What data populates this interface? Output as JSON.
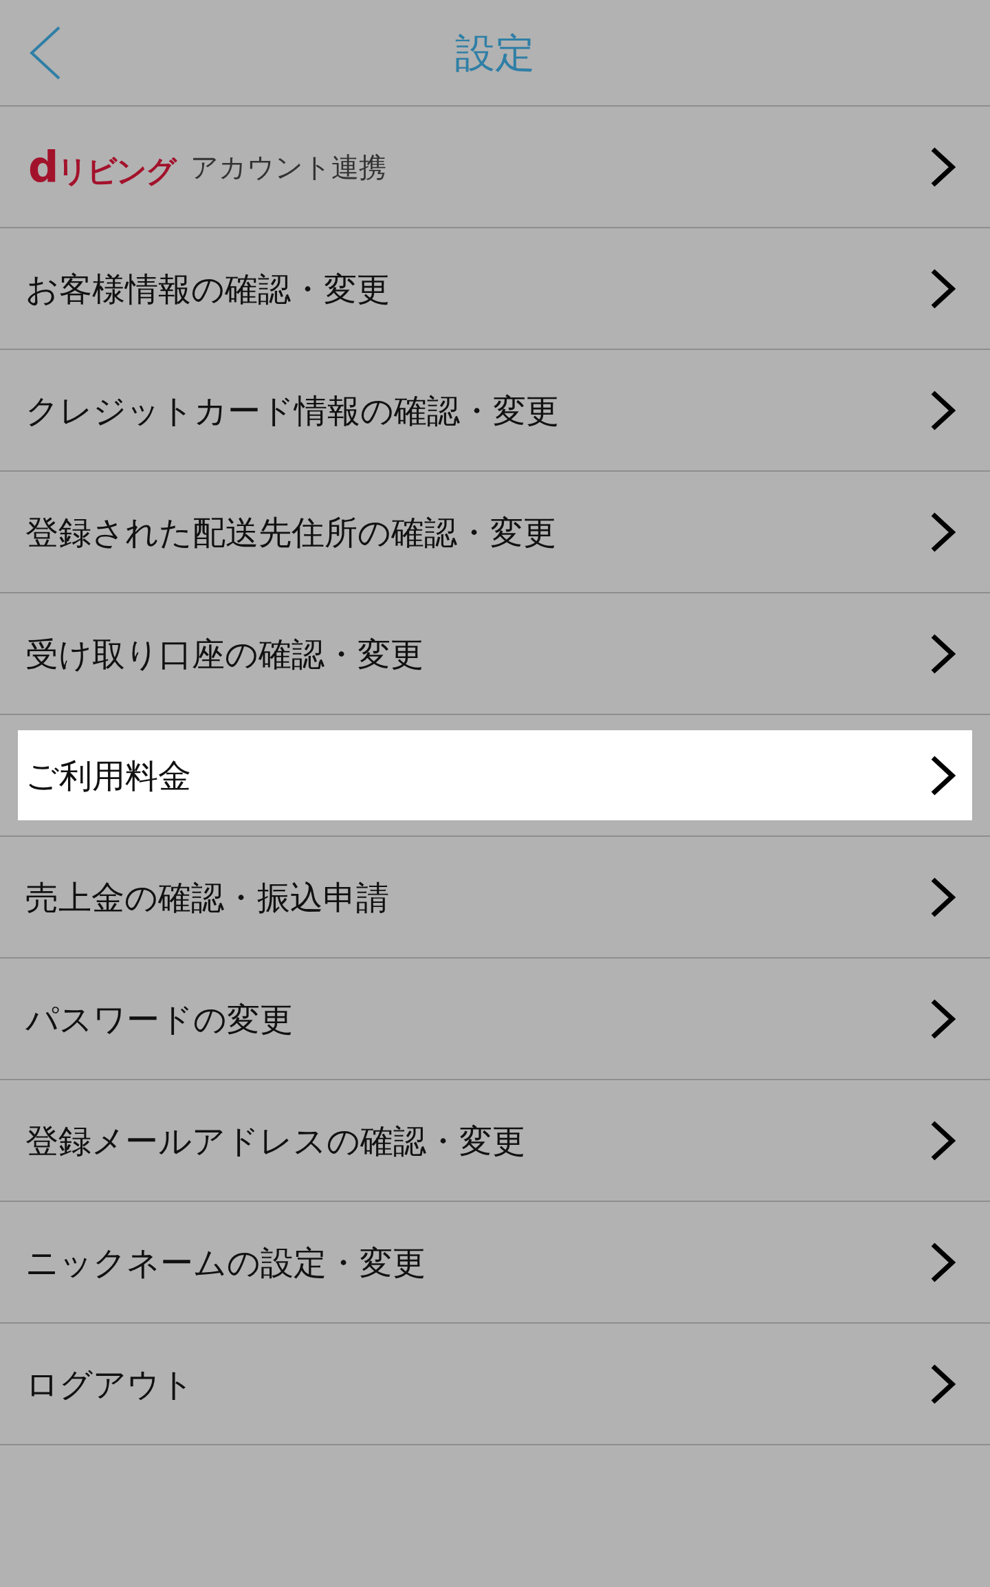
{
  "header": {
    "title": "設定"
  },
  "menu": {
    "items": [
      {
        "kind": "linked_account",
        "logo": "dリビング",
        "label": "アカウント連携",
        "selected": false
      },
      {
        "kind": "link",
        "label": "お客様情報の確認・変更",
        "selected": false
      },
      {
        "kind": "link",
        "label": "クレジットカード情報の確認・変更",
        "selected": false
      },
      {
        "kind": "link",
        "label": "登録された配送先住所の確認・変更",
        "selected": false
      },
      {
        "kind": "link",
        "label": "受け取り口座の確認・変更",
        "selected": false
      },
      {
        "kind": "link",
        "label": "ご利用料金",
        "selected": true
      },
      {
        "kind": "link",
        "label": "売上金の確認・振込申請",
        "selected": false
      },
      {
        "kind": "link",
        "label": "パスワードの変更",
        "selected": false
      },
      {
        "kind": "link",
        "label": "登録メールアドレスの確認・変更",
        "selected": false
      },
      {
        "kind": "link",
        "label": "ニックネームの設定・変更",
        "selected": false
      },
      {
        "kind": "link",
        "label": "ログアウト",
        "selected": false
      }
    ]
  }
}
